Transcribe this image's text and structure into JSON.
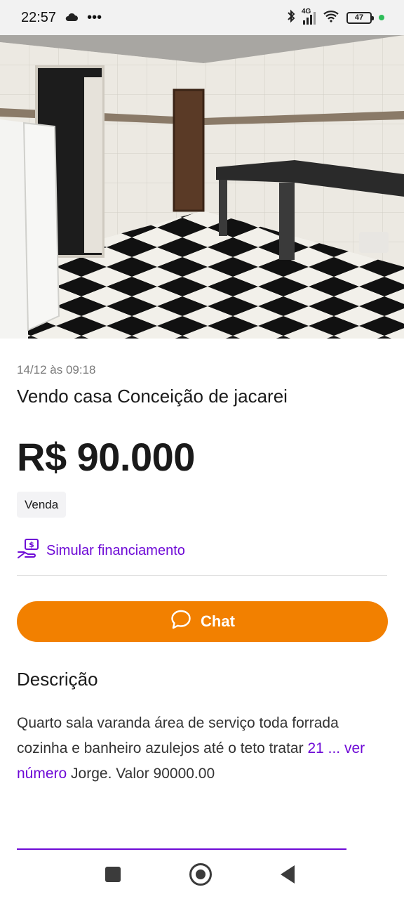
{
  "status_bar": {
    "time": "22:57",
    "overflow": "•••",
    "network": "4G",
    "battery": "47",
    "icons": [
      "cloud-icon",
      "bluetooth-icon",
      "signal-icon",
      "wifi-icon",
      "battery-icon"
    ]
  },
  "listing": {
    "date": "14/12 às 09:18",
    "title": "Vendo casa Conceição de jacarei",
    "price": "R$ 90.000",
    "tag": "Venda",
    "simulate_label": "Simular financiamento",
    "chat_label": "Chat"
  },
  "description": {
    "heading": "Descrição",
    "text_start": "Quarto sala varanda área de serviço toda forrada cozinha e banheiro azulejos até o teto tratar ",
    "phone_hidden": "21 ...",
    "reveal_label": "ver número",
    "text_end": " Jorge. Valor 90000.00"
  },
  "colors": {
    "accent_orange": "#f28000",
    "accent_purple": "#6e0ad6"
  }
}
